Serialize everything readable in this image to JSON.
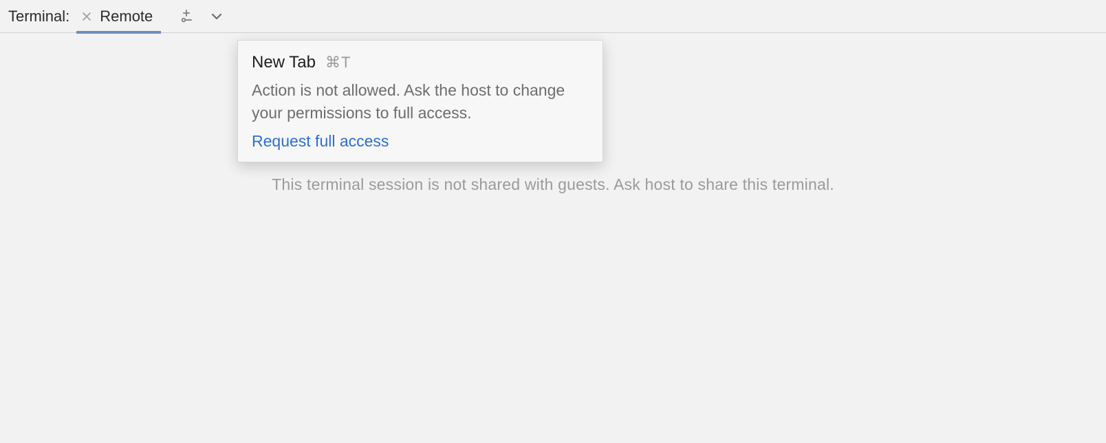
{
  "panel": {
    "label": "Terminal:"
  },
  "tabs": [
    {
      "label": "Remote",
      "active": true
    }
  ],
  "toolbar": {
    "new_session_icon": "new-session-icon",
    "dropdown_icon": "chevron-down-icon"
  },
  "content": {
    "status_message": "This terminal session is not shared with guests. Ask host to share this terminal."
  },
  "popover": {
    "title": "New Tab",
    "shortcut": "⌘T",
    "body": "Action is not allowed. Ask the host to change your permissions to full access.",
    "link": "Request full access"
  }
}
